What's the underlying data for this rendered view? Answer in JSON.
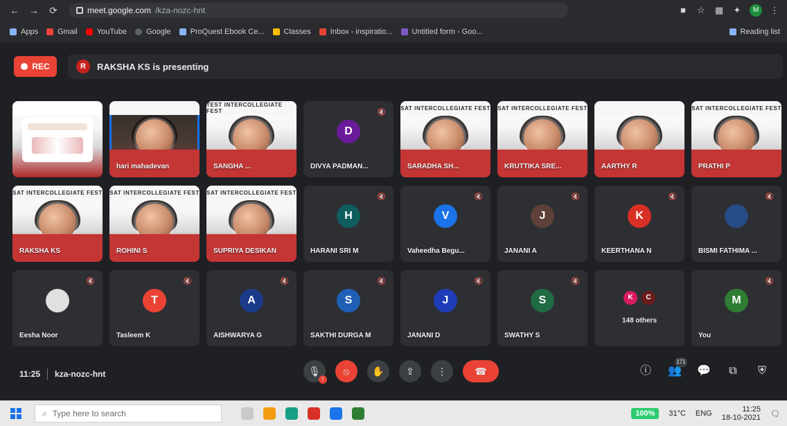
{
  "browser": {
    "url_domain": "meet.google.com",
    "url_path": "/kza-nozc-hnt",
    "bookmarks": [
      {
        "label": "Apps"
      },
      {
        "label": "Gmail"
      },
      {
        "label": "YouTube"
      },
      {
        "label": "Google"
      },
      {
        "label": "ProQuest Ebook Ce..."
      },
      {
        "label": "Classes"
      },
      {
        "label": "Inbox - inspiratio..."
      },
      {
        "label": "Untitled form - Goo..."
      }
    ],
    "reading_list_label": "Reading list",
    "profile_initial": "M"
  },
  "meet": {
    "rec_label": "REC",
    "presenter_initial": "R",
    "presenting_text": "RAKSHA KS is presenting",
    "tiles": [
      {
        "type": "slide",
        "name": "",
        "banner": ""
      },
      {
        "type": "video",
        "name": "hari mahadevan",
        "banner": "",
        "highlight": true
      },
      {
        "type": "video",
        "name": "SANGHA ...",
        "banner": "TEST INTERCOLLEGIATE FEST"
      },
      {
        "type": "avatar",
        "name": "DIVYA PADMAN...",
        "letter": "D",
        "color": "#6a1b9a"
      },
      {
        "type": "video",
        "name": "SARADHA SH...",
        "banner": "SAT INTERCOLLEGIATE FEST"
      },
      {
        "type": "video",
        "name": "KRUTTIKA SRE...",
        "banner": "SAT INTERCOLLEGIATE FEST"
      },
      {
        "type": "video",
        "name": "AARTHY R",
        "banner": ""
      },
      {
        "type": "video",
        "name": "PRATHI P",
        "banner": "SAT INTERCOLLEGIATE FEST"
      },
      {
        "type": "video",
        "name": "RAKSHA KS",
        "banner": "SAT INTERCOLLEGIATE FEST"
      },
      {
        "type": "video",
        "name": "ROHINI S",
        "banner": "SAT INTERCOLLEGIATE FEST"
      },
      {
        "type": "video",
        "name": "SUPRIYA DESIKAN",
        "banner": "SAT INTERCOLLEGIATE FEST"
      },
      {
        "type": "avatar",
        "name": "HARANI SRI M",
        "letter": "H",
        "color": "#0f5e5e"
      },
      {
        "type": "avatar",
        "name": "Vaheedha Begu...",
        "letter": "V",
        "color": "#1a73e8"
      },
      {
        "type": "avatar",
        "name": "JANANI A",
        "letter": "J",
        "color": "#5d4037"
      },
      {
        "type": "avatar",
        "name": "KEERTHANA N",
        "letter": "K",
        "color": "#d93025"
      },
      {
        "type": "avatar",
        "name": "BISMI FATHIMA ...",
        "letter": "",
        "color": "#274b86"
      },
      {
        "type": "avatar",
        "name": "Eesha Noor",
        "letter": "",
        "color": "#e0e0e0"
      },
      {
        "type": "avatar",
        "name": "Tasleem K",
        "letter": "T",
        "color": "#ea4335"
      },
      {
        "type": "avatar",
        "name": "AISHWARYA G",
        "letter": "A",
        "color": "#1a3a8a"
      },
      {
        "type": "avatar",
        "name": "SAKTHI DURGA M",
        "letter": "S",
        "color": "#1f5fb6"
      },
      {
        "type": "avatar",
        "name": "JANANI D",
        "letter": "J",
        "color": "#1e3cb8"
      },
      {
        "type": "avatar",
        "name": "SWATHY S",
        "letter": "S",
        "color": "#1e6b44"
      },
      {
        "type": "others",
        "name": "148 others",
        "letters": [
          "K",
          "C"
        ],
        "colors": [
          "#d81b60",
          "#6d1b1b"
        ]
      },
      {
        "type": "avatar",
        "name": "You",
        "letter": "M",
        "color": "#2e7d32"
      }
    ],
    "meeting_time": "11:25",
    "meeting_code": "kza-nozc-hnt",
    "participants_badge": "171"
  },
  "taskbar": {
    "search_placeholder": "Type here to search",
    "battery_pct": "100%",
    "weather": "31°C",
    "lang": "ENG",
    "time": "11:25",
    "date": "18-10-2021"
  }
}
